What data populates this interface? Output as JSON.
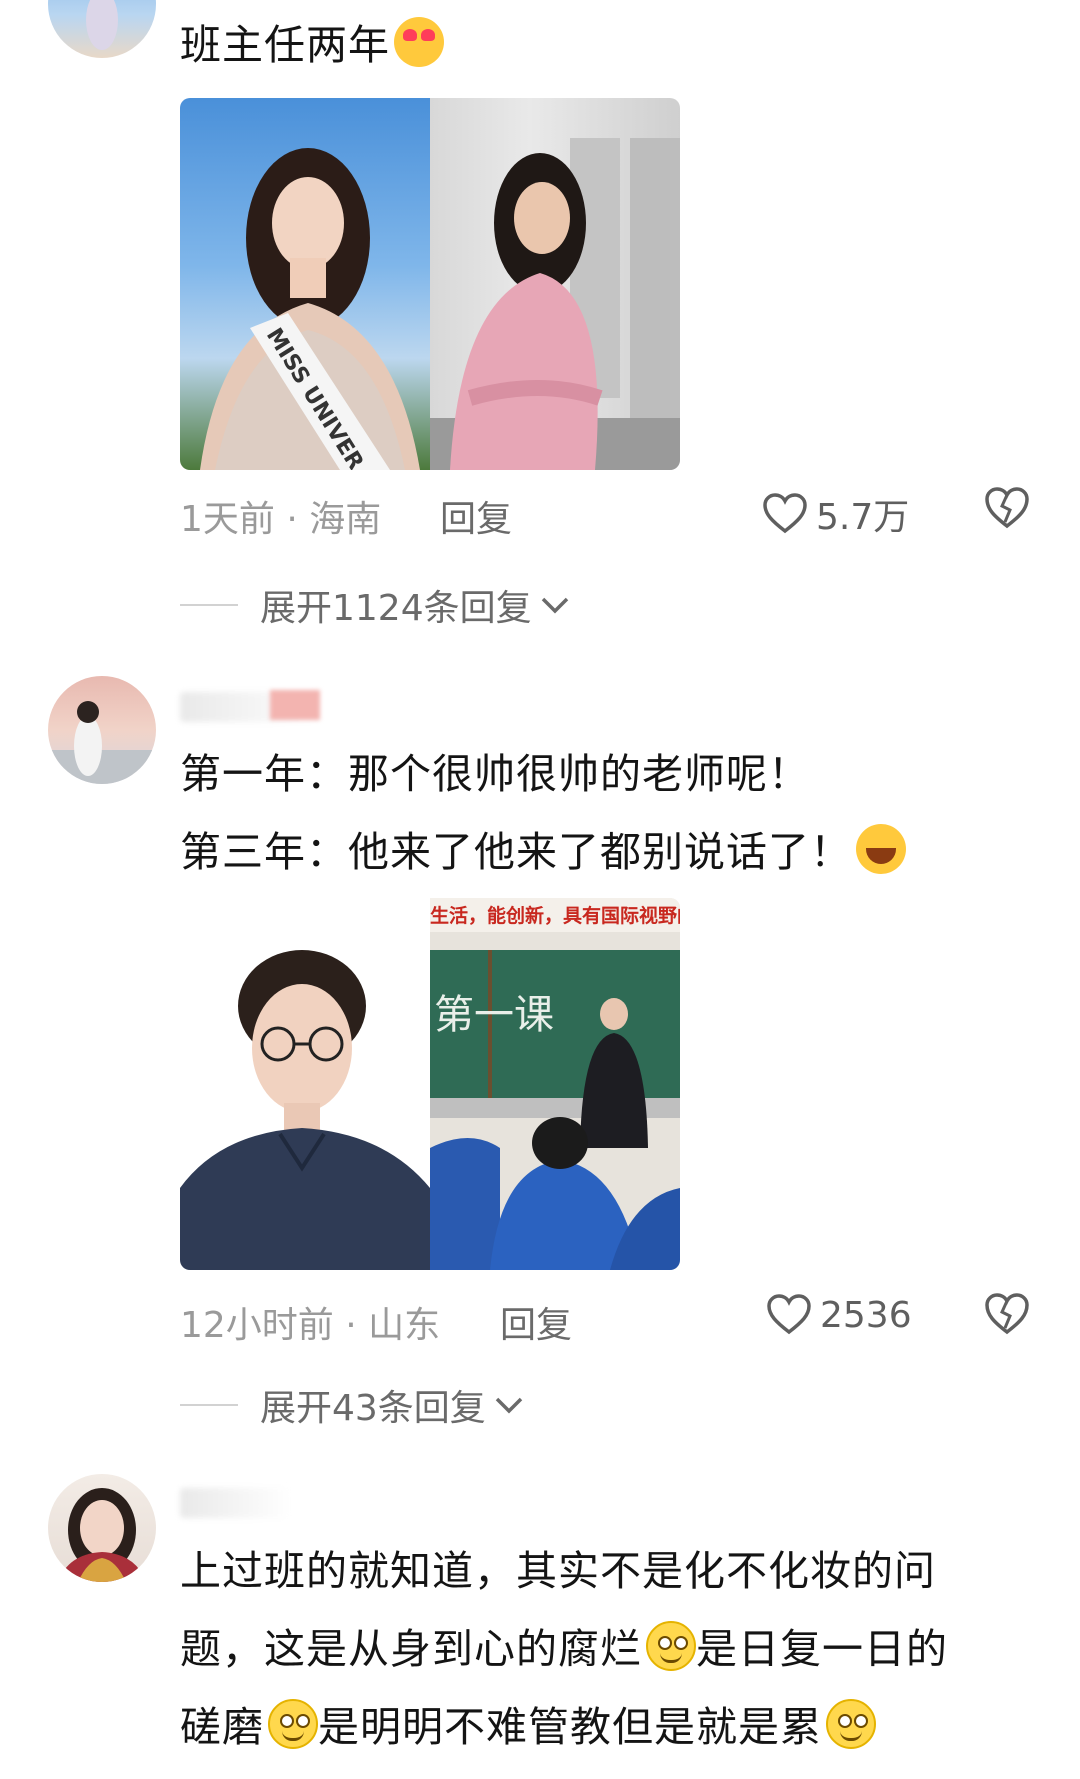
{
  "comments": [
    {
      "text_line1": "班主任两年",
      "time_location": "1天前 · 海南",
      "reply_label": "回复",
      "like_count": "5.7万",
      "expand_label": "展开1124条回复",
      "photo_left_sash_text": "MISS UNIVER"
    },
    {
      "line1": "第一年：那个很帅很帅的老师呢！",
      "line2": "第三年：他来了他来了都别说话了！",
      "time_location": "12小时前 · 山东",
      "reply_label": "回复",
      "like_count": "2536",
      "expand_label": "展开43条回复",
      "photo_right_banner": "生活，能创新，具有国际视野的",
      "photo_right_board": "第一课"
    },
    {
      "line1": "上过班的就知道，其实不是化不化妆的问",
      "line2_a": "题，这是从身到心的腐烂",
      "line2_b": "是日复一日的",
      "line3_a": "磋磨",
      "line3_b": "是明明不难管教但是就是累"
    }
  ],
  "icons": {
    "like": "heart-outline-icon",
    "dislike": "broken-heart-icon",
    "expand": "chevron-down-icon",
    "emoji_love": "heart-eyes-emoji-icon",
    "emoji_laugh": "rolling-laugh-emoji-icon",
    "emoji_grin": "grin-emoji-icon"
  }
}
